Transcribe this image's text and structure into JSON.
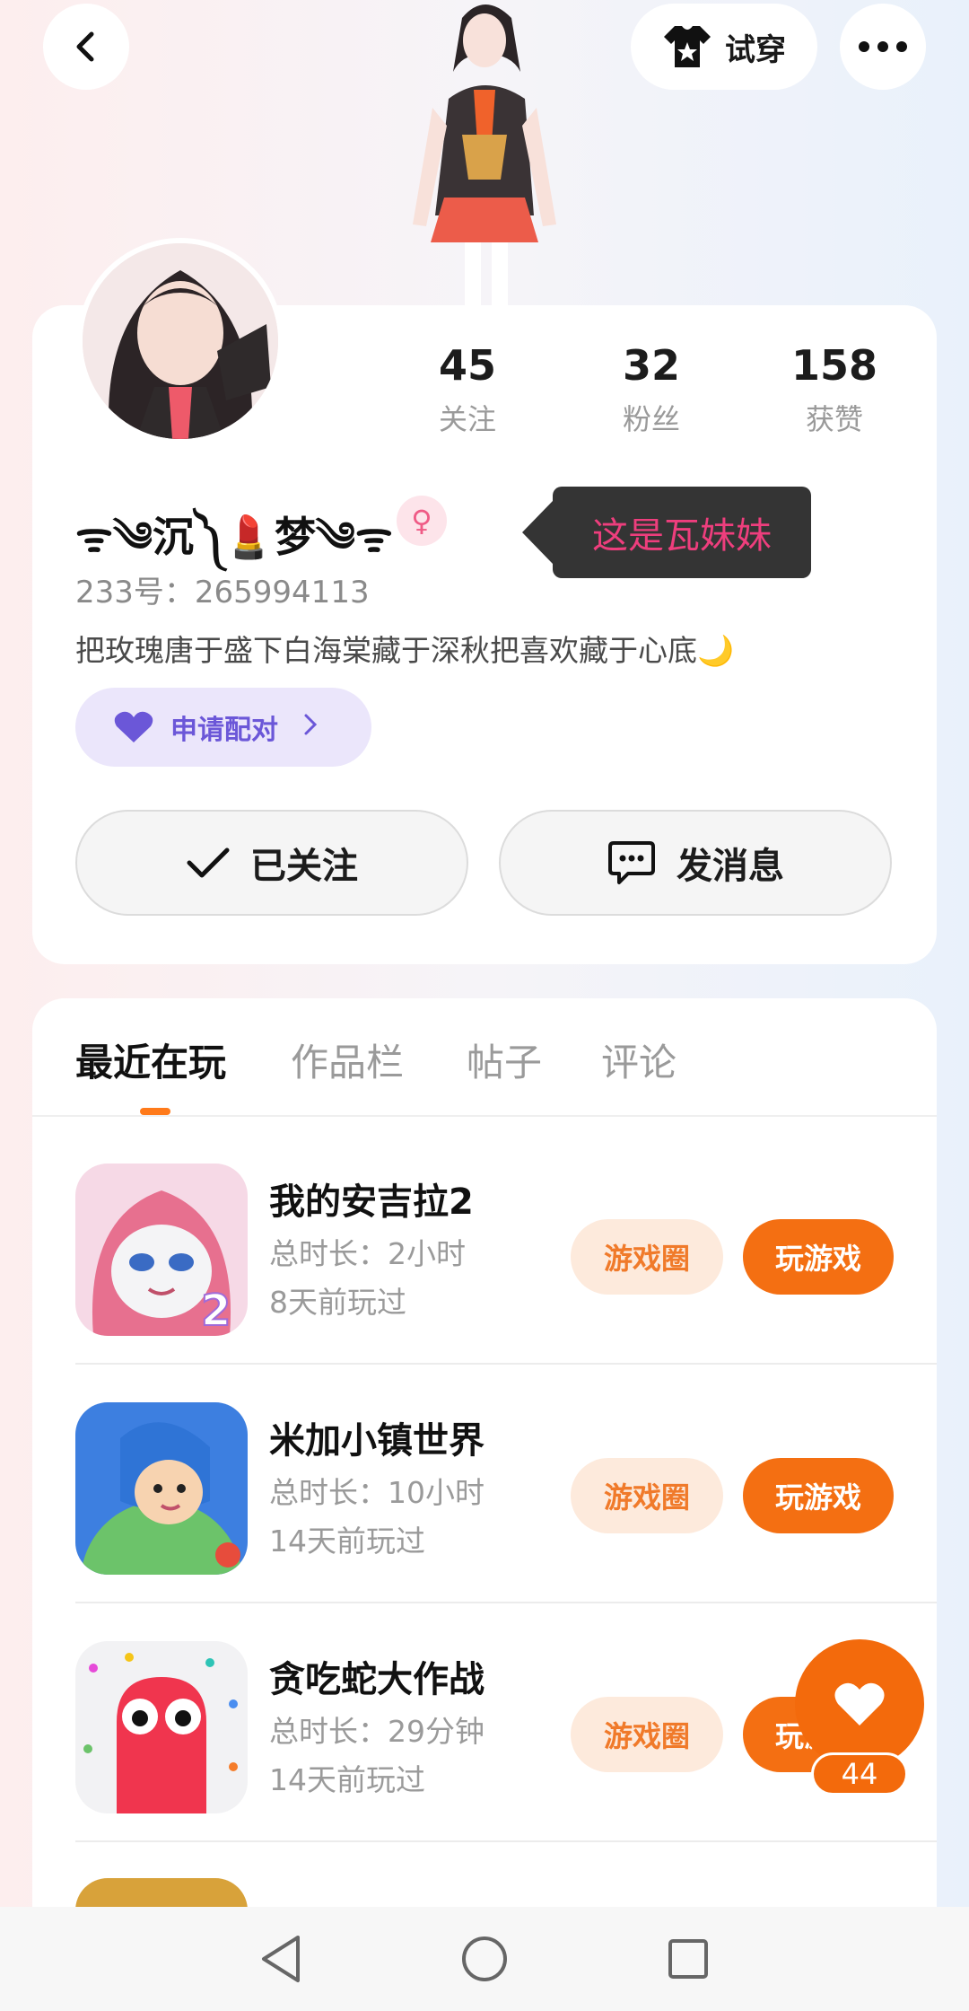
{
  "header": {
    "try_on_label": "试穿"
  },
  "profile": {
    "stats": [
      {
        "value": "45",
        "label": "关注"
      },
      {
        "value": "32",
        "label": "粉丝"
      },
      {
        "value": "158",
        "label": "获赞"
      }
    ],
    "nickname": "ᯤ༄沉༽💄梦༄ᯤ",
    "gender_symbol": "♀",
    "tooltip": "这是瓦妹妹",
    "uid": "233号：265994113",
    "bio": "把玫瑰唐于盛下白海棠藏于深秋把喜欢藏于心底🌙",
    "pair_label": "申请配对",
    "follow_label": "已关注",
    "message_label": "发消息"
  },
  "tabs": [
    {
      "label": "最近在玩",
      "active": true
    },
    {
      "label": "作品栏",
      "active": false
    },
    {
      "label": "帖子",
      "active": false
    },
    {
      "label": "评论",
      "active": false
    }
  ],
  "games": [
    {
      "title": "我的安吉拉2",
      "duration": "总时长：2小时",
      "last_played": "8天前玩过",
      "circle_label": "游戏圈",
      "play_label": "玩游戏"
    },
    {
      "title": "米加小镇世界",
      "duration": "总时长：10小时",
      "last_played": "14天前玩过",
      "circle_label": "游戏圈",
      "play_label": "玩游戏"
    },
    {
      "title": "贪吃蛇大作战",
      "duration": "总时长：29分钟",
      "last_played": "14天前玩过",
      "circle_label": "游戏圈",
      "play_label": "玩游戏"
    }
  ],
  "like": {
    "count": "44"
  },
  "colors": {
    "accent": "#f46f12",
    "pair_purple": "#6b57d8",
    "tooltip_pink": "#ee3e7d"
  },
  "icons": [
    "back-icon",
    "shirt-star-icon",
    "more-icon",
    "heart-icon",
    "chevron-right-icon",
    "checkmark-icon",
    "chat-bubble-icon",
    "nav-back-icon",
    "nav-home-icon",
    "nav-recents-icon"
  ]
}
